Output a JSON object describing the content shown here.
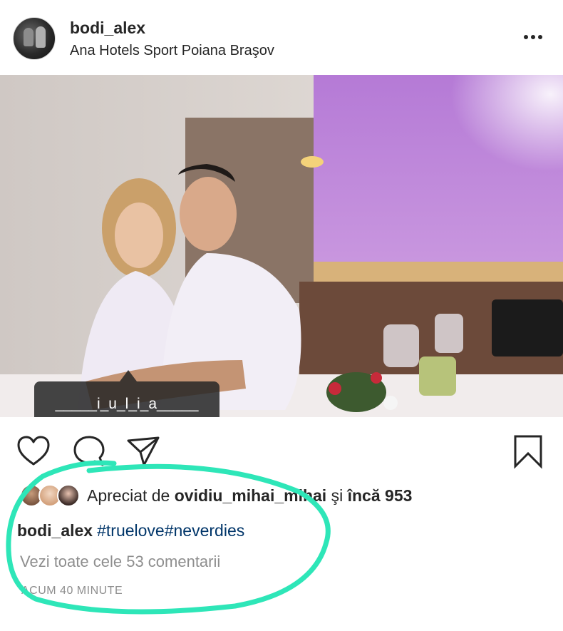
{
  "post": {
    "username": "bodi_alex",
    "location": "Ana Hotels Sport Poiana Braşov",
    "photo_tag": "_____i_u_l_i_a_____",
    "likes": {
      "prefix": "Apreciat de",
      "user": "ovidiu_mihai_mihai",
      "middle": "şi",
      "others": "încă 953"
    },
    "caption": {
      "user": "bodi_alex",
      "hashtags": "#truelove#neverdies"
    },
    "view_comments": "Vezi toate cele 53 comentarii",
    "timestamp": "ACUM 40 MINUTE"
  },
  "icons": {
    "more": "more-options-icon",
    "like": "heart-icon",
    "comment": "comment-bubble-icon",
    "share": "paper-plane-icon",
    "save": "bookmark-icon"
  },
  "colors": {
    "text": "#262626",
    "secondary": "#8e8e8e",
    "hashtag": "#003569",
    "highlight": "#2ee6b8"
  }
}
